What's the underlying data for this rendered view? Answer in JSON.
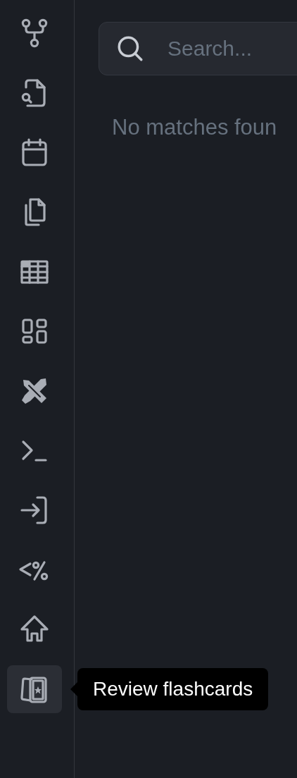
{
  "sidebar": {
    "items": [
      {
        "kind": "branches",
        "selected": false
      },
      {
        "kind": "file-search",
        "selected": false
      },
      {
        "kind": "calendar",
        "selected": false
      },
      {
        "kind": "copy",
        "selected": false
      },
      {
        "kind": "table",
        "selected": false
      },
      {
        "kind": "dashboard",
        "selected": false
      },
      {
        "kind": "tools",
        "selected": false
      },
      {
        "kind": "terminal",
        "selected": false
      },
      {
        "kind": "login",
        "selected": false
      },
      {
        "kind": "template",
        "selected": false
      },
      {
        "kind": "home",
        "selected": false
      },
      {
        "kind": "flashcards",
        "selected": true,
        "tooltip": "Review flashcards"
      }
    ]
  },
  "search": {
    "placeholder": "Search..."
  },
  "results": {
    "empty_message": "No matches foun"
  }
}
